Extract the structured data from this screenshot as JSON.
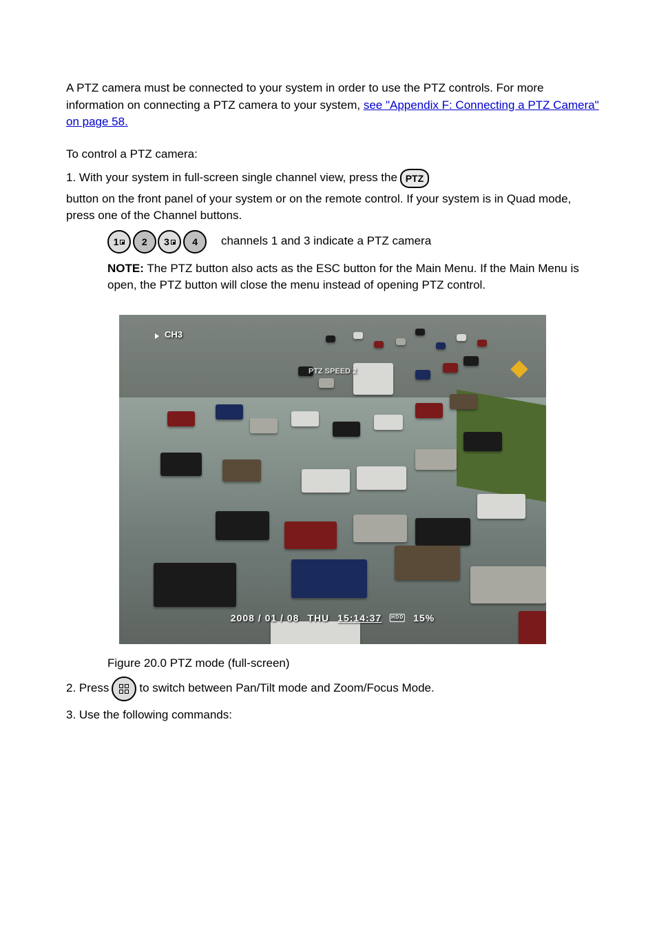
{
  "paragraphs": {
    "intro": "A PTZ camera must be connected to your system in order to use the PTZ controls. For more information on connecting a PTZ camera to your system, ",
    "link_text": "see \"Appendix F: Connecting ",
    "link_tail": "a PTZ Camera\" on page 58.",
    "to_control": "To control a PTZ camera:",
    "step1_pre": "1. With your system in full-screen single channel view, press the ",
    "step1_post": " button on the front panel of your system or on the remote control. If your system is in Quad mode, press one of the Channel buttons.",
    "note_label": "NOTE:",
    "note_text": " The PTZ button also acts as the ESC button for the Main Menu. If the Main Menu is open, the PTZ button will close the menu instead of opening PTZ control.",
    "numbers_note": "channels 1 and 3 indicate a PTZ camera",
    "step2": "Figure 20.0 PTZ mode (full-screen)",
    "step3_prefix": "2. Press ",
    "step3_suffix": " to switch between Pan/Tilt mode and Zoom/Focus Mode.",
    "fig_label_prefix": "3. Use the following commands:"
  },
  "buttons": {
    "ptz": "PTZ",
    "n1": "1",
    "n2": "2",
    "n3": "3",
    "n4": "4"
  },
  "osd": {
    "channel": "CH3",
    "ptz_speed": "PTZ SPEED 2",
    "date": "2008 / 01 / 08",
    "day": "THU",
    "time": "15:14:37",
    "pct": "15%"
  }
}
